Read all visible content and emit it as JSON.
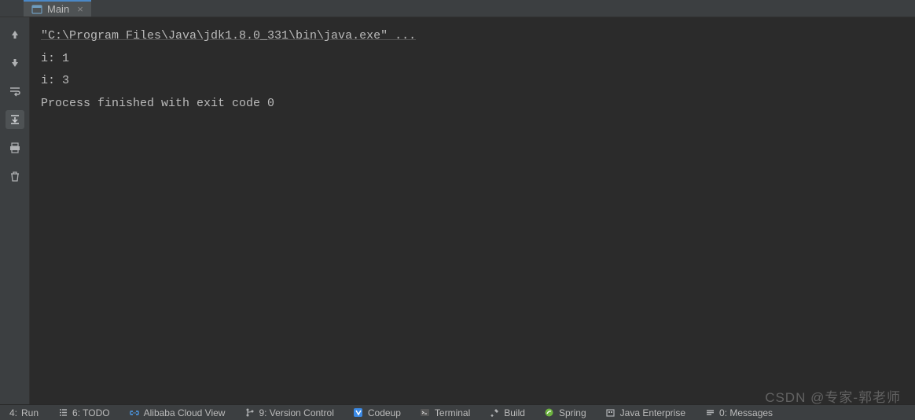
{
  "tab": {
    "label": "Main",
    "icon": "console-icon"
  },
  "console": {
    "command": "\"C:\\Program Files\\Java\\jdk1.8.0_331\\bin\\java.exe\" ...",
    "lines": [
      "i: 1",
      "i: 3",
      "",
      "Process finished with exit code 0"
    ]
  },
  "bottom": {
    "run": "Run",
    "run_prefix": "4:",
    "todo": "6: TODO",
    "alibaba": "Alibaba Cloud View",
    "version_control": "9: Version Control",
    "codeup": "Codeup",
    "terminal": "Terminal",
    "build": "Build",
    "spring": "Spring",
    "java_enterprise": "Java Enterprise",
    "messages": "0: Messages"
  },
  "watermark": "CSDN @专家-郭老师"
}
